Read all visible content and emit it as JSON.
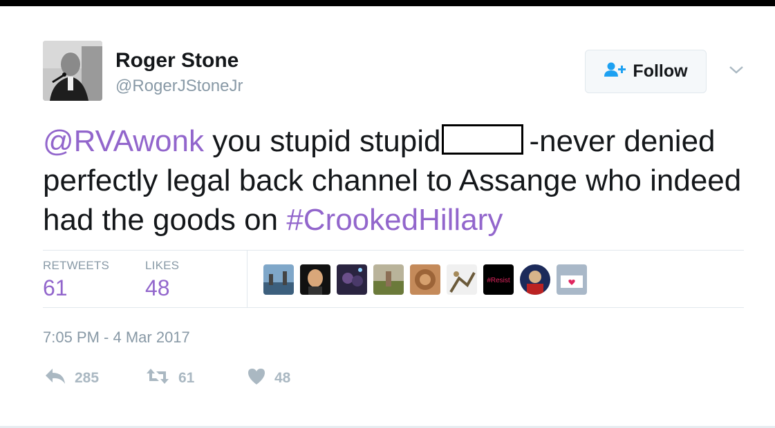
{
  "user": {
    "name": "Roger Stone",
    "handle": "@RogerJStoneJr"
  },
  "follow_button": {
    "label": "Follow"
  },
  "tweet": {
    "mention": "@RVAwonk",
    "text_1": " you stupid stupid",
    "text_2": "-never denied perfectly legal back channel to Assange who indeed had the goods on ",
    "hashtag": "#CrookedHillary"
  },
  "stats": {
    "retweets_label": "RETWEETS",
    "retweets_value": "61",
    "likes_label": "LIKES",
    "likes_value": "48"
  },
  "likers": [
    {
      "name": "liker-1"
    },
    {
      "name": "liker-2"
    },
    {
      "name": "liker-3"
    },
    {
      "name": "liker-4"
    },
    {
      "name": "liker-5"
    },
    {
      "name": "liker-6"
    },
    {
      "name": "liker-7",
      "text": "#Resist"
    },
    {
      "name": "liker-8"
    },
    {
      "name": "liker-9"
    }
  ],
  "timestamp": "7:05 PM - 4 Mar 2017",
  "actions": {
    "reply_count": "285",
    "retweet_count": "61",
    "like_count": "48"
  },
  "colors": {
    "link": "#9266cc",
    "muted": "#8899a6",
    "action_icon": "#aab8c2",
    "follow_icon": "#1da1f2"
  },
  "icons": [
    "follow-person-icon",
    "chevron-down-icon",
    "reply-icon",
    "retweet-icon",
    "heart-icon"
  ]
}
